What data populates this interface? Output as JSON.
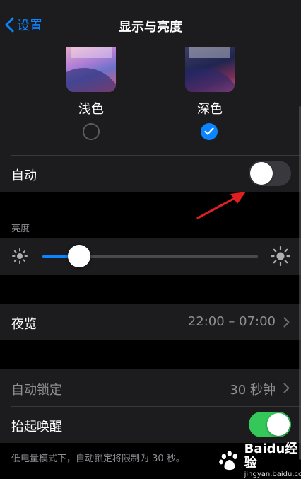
{
  "nav": {
    "back_label": "设置",
    "title": "显示与亮度"
  },
  "appearance": {
    "light_label": "浅色",
    "dark_label": "深色",
    "selected": "dark"
  },
  "automatic": {
    "label": "自动",
    "enabled": false
  },
  "brightness": {
    "section_label": "亮度",
    "level": 0.17
  },
  "night_shift": {
    "label": "夜览",
    "value": "22:00 – 07:00"
  },
  "auto_lock": {
    "label": "自动锁定",
    "value": "30 秒钟",
    "disabled": true
  },
  "raise_to_wake": {
    "label": "抬起唤醒",
    "enabled": true
  },
  "footnote": "低电量模式下，自动锁定将限制为 30 秒。",
  "watermark": {
    "brand": "Baidu经验",
    "url": "jingyan.baidu.com"
  },
  "colors": {
    "accent": "#0a84ff",
    "switch_on": "#34c759",
    "annotation_arrow": "#e02020"
  }
}
